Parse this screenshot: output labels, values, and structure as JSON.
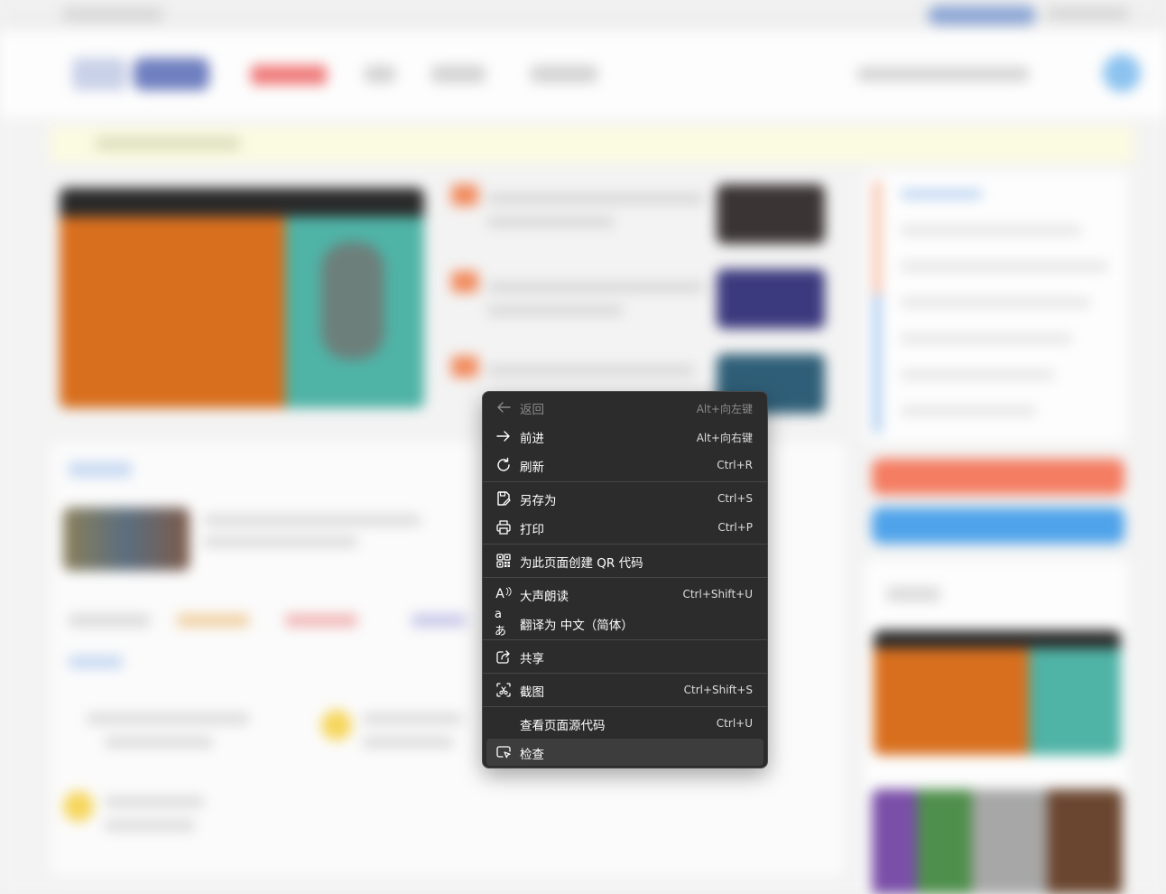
{
  "context_menu": {
    "items": [
      {
        "label": "返回",
        "shortcut": "Alt+向左键",
        "icon": "arrow-left-icon",
        "enabled": false
      },
      {
        "label": "前进",
        "shortcut": "Alt+向右键",
        "icon": "arrow-right-icon",
        "enabled": true
      },
      {
        "label": "刷新",
        "shortcut": "Ctrl+R",
        "icon": "refresh-icon",
        "enabled": true
      },
      {
        "label": "另存为",
        "shortcut": "Ctrl+S",
        "icon": "save-as-icon",
        "enabled": true
      },
      {
        "label": "打印",
        "shortcut": "Ctrl+P",
        "icon": "printer-icon",
        "enabled": true
      },
      {
        "label": "为此页面创建 QR 代码",
        "shortcut": "",
        "icon": "qr-code-icon",
        "enabled": true
      },
      {
        "label": "大声朗读",
        "shortcut": "Ctrl+Shift+U",
        "icon": "read-aloud-icon",
        "enabled": true
      },
      {
        "label": "翻译为 中文（简体）",
        "shortcut": "",
        "icon": "translate-icon",
        "enabled": true
      },
      {
        "label": "共享",
        "shortcut": "",
        "icon": "share-icon",
        "enabled": true
      },
      {
        "label": "截图",
        "shortcut": "Ctrl+Shift+S",
        "icon": "screenshot-icon",
        "enabled": true
      },
      {
        "label": "查看页面源代码",
        "shortcut": "Ctrl+U",
        "icon": "",
        "enabled": true
      },
      {
        "label": "检查",
        "shortcut": "",
        "icon": "inspect-icon",
        "enabled": true,
        "hovered": true
      }
    ],
    "icon_glyphs": {
      "read_aloud": "A",
      "translate": "aあ"
    }
  },
  "colors": {
    "menu_background": "#2c2c2c",
    "menu_hover": "#3d3d3d",
    "menu_text": "#ffffff",
    "menu_disabled_text": "#8a8a8a"
  }
}
